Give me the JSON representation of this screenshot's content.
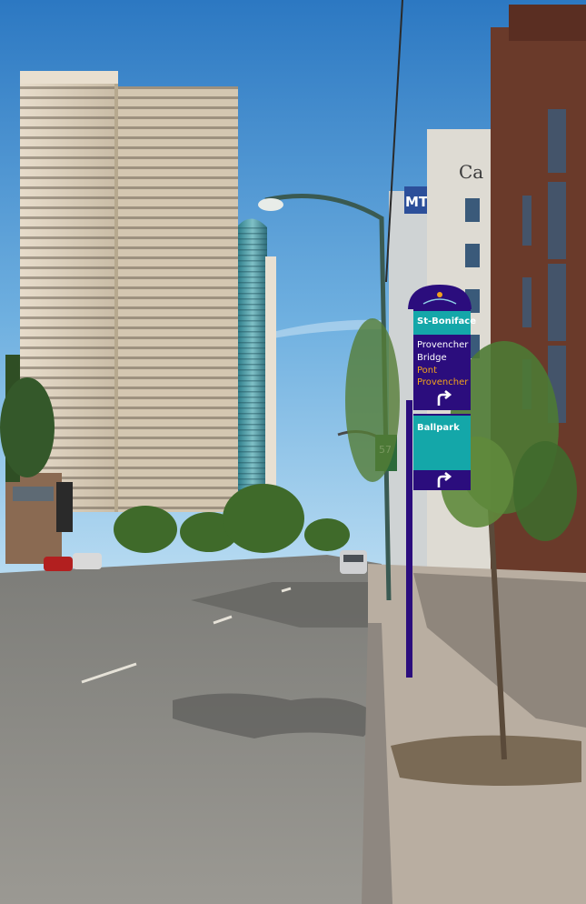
{
  "scene": {
    "description_colors": {
      "sky_top": "#2f7fc6",
      "sky_bottom": "#a9d2ee",
      "road": "#8b8b87",
      "sidewalk": "#b9aea1",
      "sign_navy": "#2b0d7d",
      "sign_teal": "#0fa6a8",
      "sign_orange": "#f2a21c"
    },
    "building_sign_text": "Ca",
    "building_logo_text": "MT",
    "street_sign_text": "57"
  },
  "sign": {
    "panel1": {
      "header": "St-Boniface",
      "line1": "Provencher",
      "line2": "Bridge",
      "line3": "Pont",
      "line4": "Provencher",
      "arrow_icon": "turn-right-arrow"
    },
    "panel2": {
      "header": "Ballpark",
      "arrow_icon": "turn-right-arrow"
    }
  }
}
